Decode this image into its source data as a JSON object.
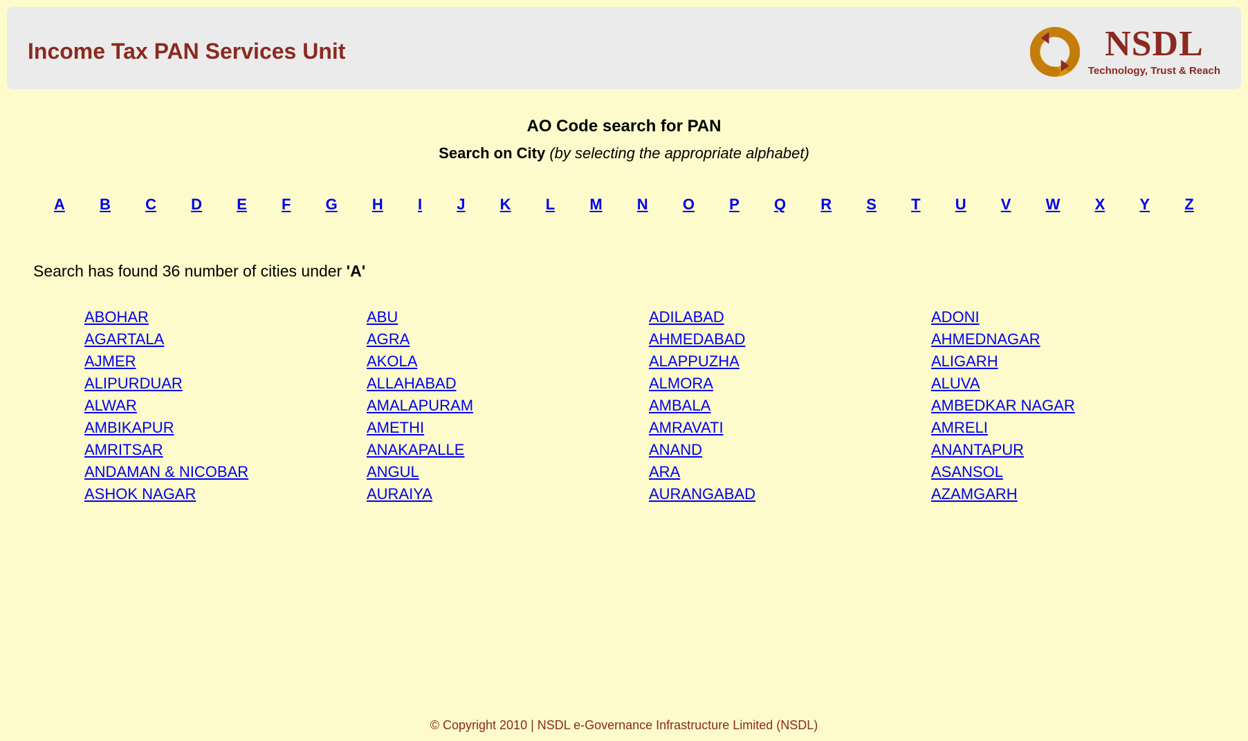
{
  "header": {
    "title": "Income Tax PAN Services Unit",
    "logo_main": "NSDL",
    "logo_tag": "Technology, Trust & Reach"
  },
  "main": {
    "heading": "AO Code search for PAN",
    "sub_strong": "Search on City",
    "sub_italic": "(by selecting the appropriate alphabet)",
    "alphabets": [
      "A",
      "B",
      "C",
      "D",
      "E",
      "F",
      "G",
      "H",
      "I",
      "J",
      "K",
      "L",
      "M",
      "N",
      "O",
      "P",
      "Q",
      "R",
      "S",
      "T",
      "U",
      "V",
      "W",
      "X",
      "Y",
      "Z"
    ],
    "result_prefix": "Search has found ",
    "result_count": "36",
    "result_mid": " number of cities under ",
    "result_letter": "'A'",
    "cities": [
      "ABOHAR",
      "ABU",
      "ADILABAD",
      "ADONI",
      "AGARTALA",
      "AGRA",
      "AHMEDABAD",
      "AHMEDNAGAR",
      "AJMER",
      "AKOLA",
      "ALAPPUZHA",
      "ALIGARH",
      "ALIPURDUAR",
      "ALLAHABAD",
      "ALMORA",
      "ALUVA",
      "ALWAR",
      "AMALAPURAM",
      "AMBALA",
      "AMBEDKAR NAGAR",
      "AMBIKAPUR",
      "AMETHI",
      "AMRAVATI",
      "AMRELI",
      "AMRITSAR",
      "ANAKAPALLE",
      "ANAND",
      "ANANTAPUR",
      "ANDAMAN & NICOBAR",
      "ANGUL",
      "ARA",
      "ASANSOL",
      "ASHOK NAGAR",
      "AURAIYA",
      "AURANGABAD",
      "AZAMGARH"
    ]
  },
  "footer": {
    "copy": "© Copyright 2010  |  NSDL e-Governance Infrastructure Limited (NSDL)"
  }
}
